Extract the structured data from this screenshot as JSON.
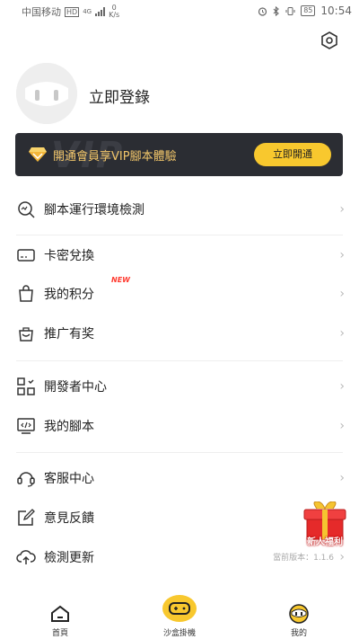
{
  "status_bar": {
    "carrier": "中国移动",
    "hd": "HD",
    "net_top": "4G",
    "speed_value": "0",
    "speed_unit": "K/s",
    "battery": "85",
    "time": "10:54"
  },
  "profile": {
    "login_label": "立即登錄"
  },
  "vip_banner": {
    "text": "開通會員享VIP腳本體驗",
    "button": "立即開通",
    "watermark": "VIP"
  },
  "menu": {
    "env_check": "腳本運行環境檢測",
    "card_redeem": "卡密兌換",
    "my_points": "我的积分",
    "new_badge": "NEW",
    "promote": "推广有奖",
    "developer_center": "開發者中心",
    "my_scripts": "我的腳本",
    "customer_service": "客服中心",
    "feedback": "意見反饋",
    "check_update": "檢測更新",
    "version_text": "當前版本：1.1.6"
  },
  "gift": {
    "label": "新人福利"
  },
  "tabs": {
    "home": "首頁",
    "sandbox": "沙盒掛機",
    "mine": "我的"
  },
  "colors": {
    "accent": "#f8c82e",
    "banner_bg": "#2b2d33",
    "banner_text": "#f2c66a"
  }
}
